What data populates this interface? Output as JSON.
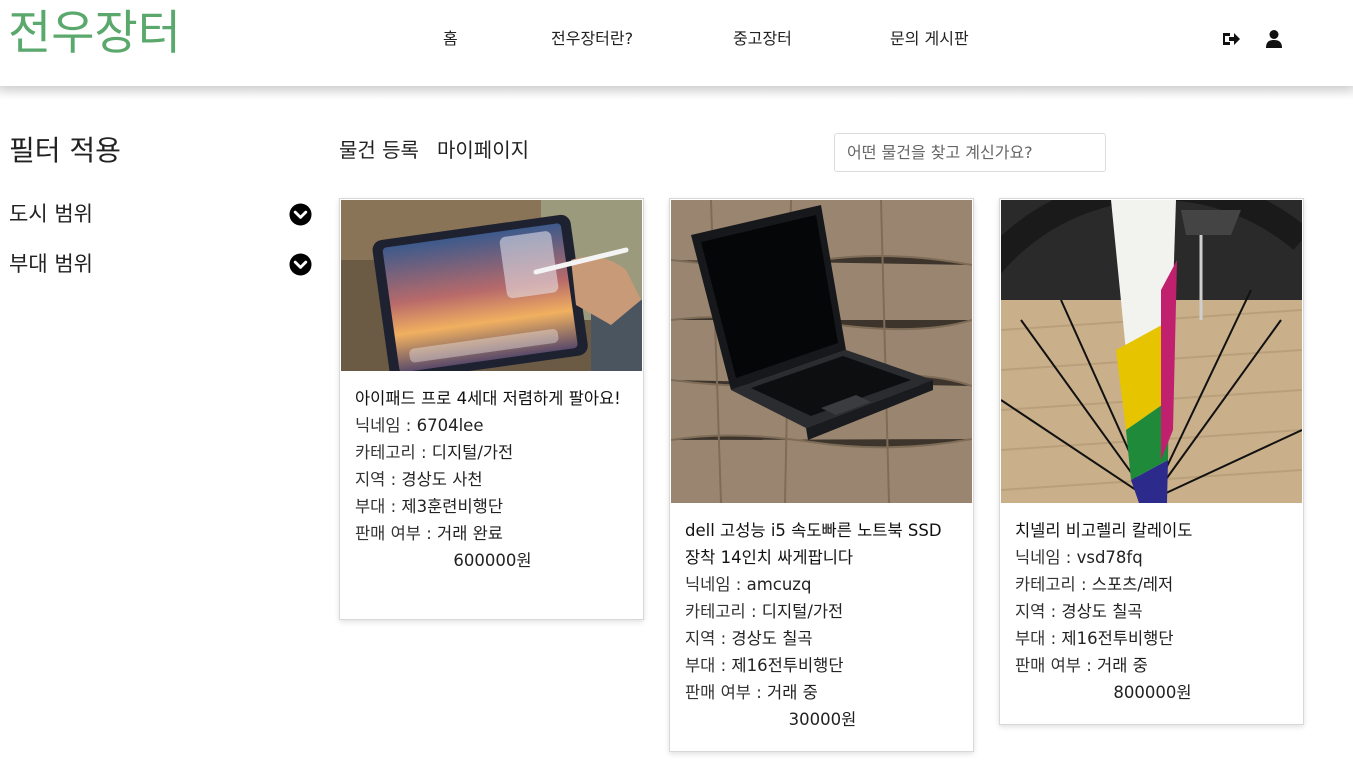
{
  "header": {
    "logo": "전우장터",
    "nav": [
      "홈",
      "전우장터란?",
      "중고장터",
      "문의 게시판"
    ],
    "icons": [
      "logout-icon",
      "user-icon"
    ]
  },
  "sidebar": {
    "title": "필터 적용",
    "filters": [
      "도시 범위",
      "부대 범위"
    ]
  },
  "toolbar": {
    "register": "물건 등록",
    "mypage": "마이페이지",
    "search_placeholder": "어떤 물건을 찾고 계신가요?"
  },
  "products": [
    {
      "title": "아이패드 프로 4세대 저렴하게 팔아요!",
      "nickname_label": "닉네임 : ",
      "nickname": "6704lee",
      "category_label": "카테고리 : ",
      "category": "디지털/가전",
      "region_label": "지역 : ",
      "region": "경상도 사천",
      "unit_label": "부대 : ",
      "unit": "제3훈련비행단",
      "status_label": "판매 여부 : ",
      "status": "거래 완료",
      "price": "600000원"
    },
    {
      "title": "dell 고성능 i5 속도빠른 노트북 SSD 장착 14인치 싸게팝니다",
      "nickname_label": "닉네임 : ",
      "nickname": "amcuzq",
      "category_label": "카테고리 : ",
      "category": "디지털/가전",
      "region_label": "지역 : ",
      "region": "경상도 칠곡",
      "unit_label": "부대 : ",
      "unit": "제16전투비행단",
      "status_label": "판매 여부 : ",
      "status": "거래 중",
      "price": "30000원"
    },
    {
      "title": "치넬리 비고렐리 칼레이도",
      "nickname_label": "닉네임 : ",
      "nickname": "vsd78fq",
      "category_label": "카테고리 : ",
      "category": "스포츠/레저",
      "region_label": "지역 : ",
      "region": "경상도 칠곡",
      "unit_label": "부대 : ",
      "unit": "제16전투비행단",
      "status_label": "판매 여부 : ",
      "status": "거래 중",
      "price": "800000원"
    }
  ]
}
